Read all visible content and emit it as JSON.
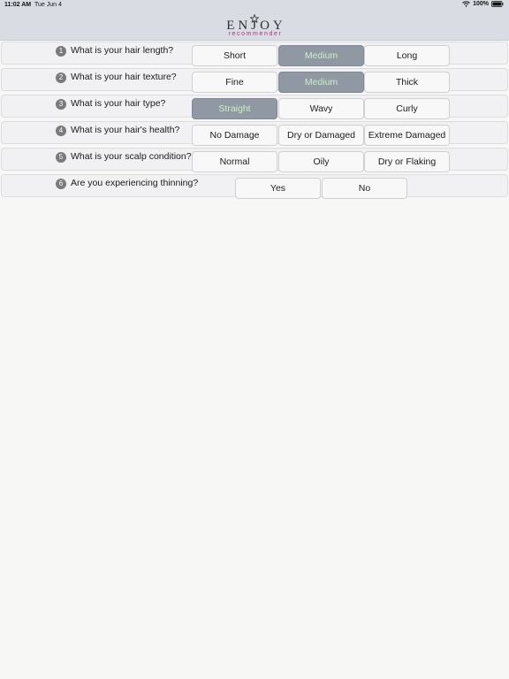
{
  "status_bar": {
    "time": "11:02 AM",
    "date": "Tue Jun 4",
    "battery": "100%"
  },
  "header": {
    "logo_word": "ENJOY",
    "logo_sub": "recommender"
  },
  "questions": [
    {
      "number": "1",
      "text": "What is your hair length?",
      "options": [
        "Short",
        "Medium",
        "Long"
      ],
      "selected": "Medium"
    },
    {
      "number": "2",
      "text": "What is your hair texture?",
      "options": [
        "Fine",
        "Medium",
        "Thick"
      ],
      "selected": "Medium"
    },
    {
      "number": "3",
      "text": "What is your hair type?",
      "options": [
        "Straight",
        "Wavy",
        "Curly"
      ],
      "selected": "Straight"
    },
    {
      "number": "4",
      "text": "What is your hair's health?",
      "options": [
        "No Damage",
        "Dry or Damaged",
        "Extreme Damaged"
      ],
      "selected": ""
    },
    {
      "number": "5",
      "text": "What is your scalp condition?",
      "options": [
        "Normal",
        "Oily",
        "Dry or Flaking"
      ],
      "selected": ""
    },
    {
      "number": "6",
      "text": "Are you experiencing thinning?",
      "options": [
        "Yes",
        "No"
      ],
      "selected": ""
    }
  ],
  "colors": {
    "header_bg": "#d9dde3",
    "selected_bg": "#8f98a3",
    "selected_text": "#cfeec6",
    "logo_accent": "#a7357a"
  }
}
